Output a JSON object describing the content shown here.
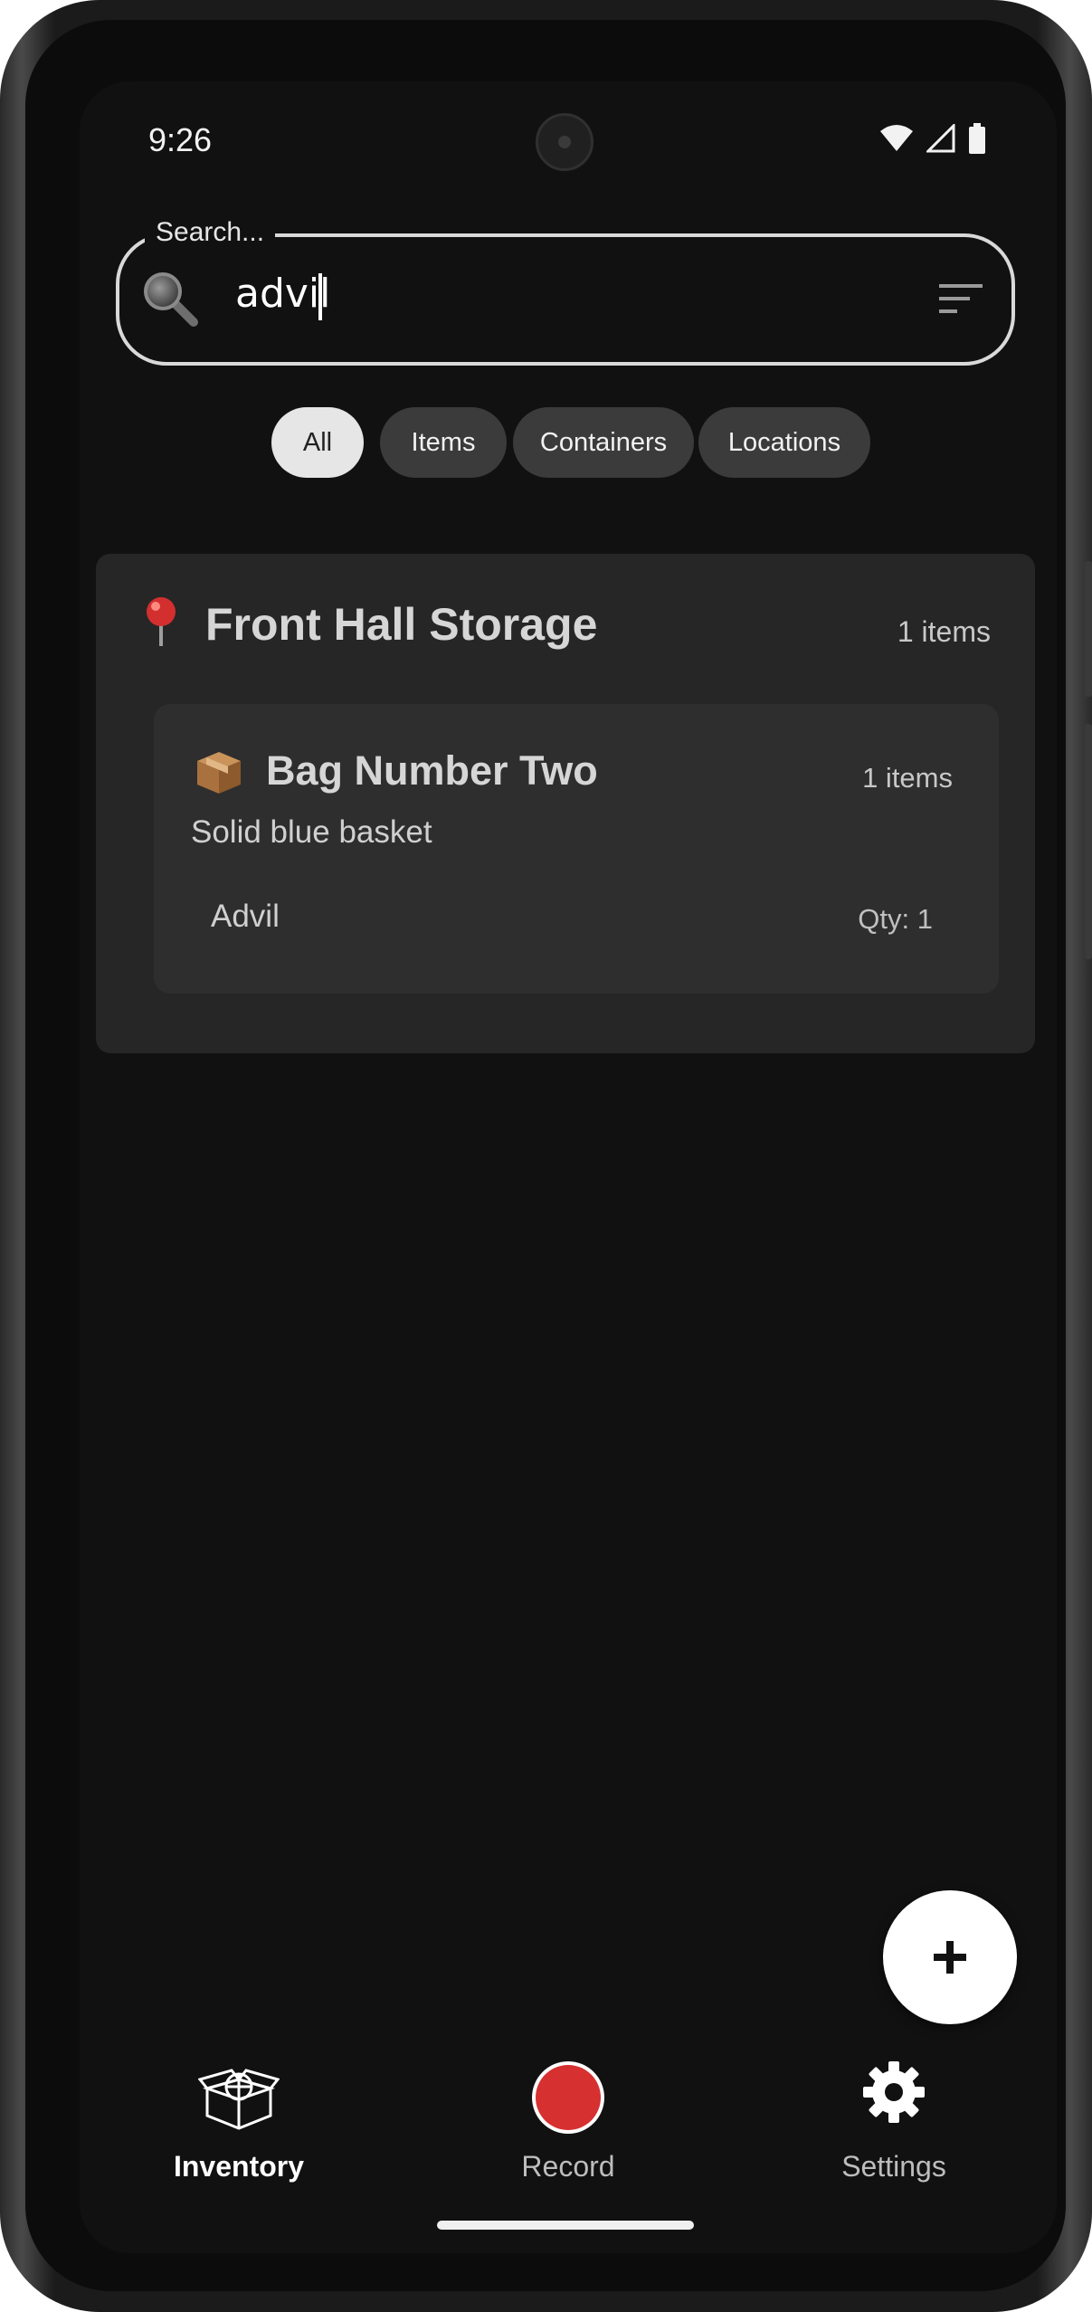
{
  "status_bar": {
    "time": "9:26"
  },
  "search": {
    "label": "Search...",
    "value": "advil"
  },
  "filters": {
    "chips": [
      "All",
      "Items",
      "Containers",
      "Locations"
    ],
    "selected": "All"
  },
  "location": {
    "name": "Front Hall Storage",
    "count": "1 items",
    "container": {
      "name": "Bag Number Two",
      "count": "1 items",
      "description": "Solid blue basket",
      "item": {
        "name": "Advil",
        "qty": "Qty: 1"
      }
    }
  },
  "nav": {
    "inventory": "Inventory",
    "record": "Record",
    "settings": "Settings"
  },
  "colors": {
    "record_red": "#d63031",
    "background": "#111111",
    "card": "#262626"
  }
}
